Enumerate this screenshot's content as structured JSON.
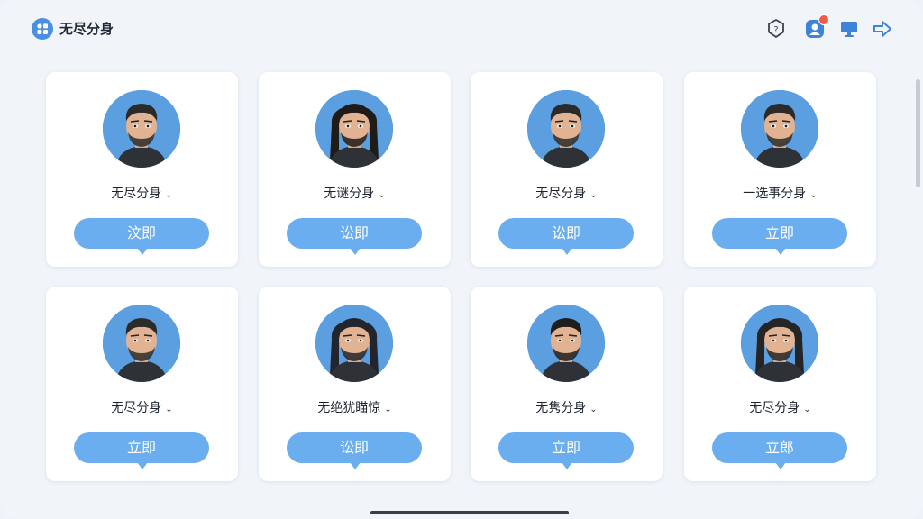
{
  "app": {
    "title": "无尽分身"
  },
  "toolbar": {
    "icons": [
      "help-icon",
      "profile-notify-icon",
      "monitor-icon",
      "forward-arrow-icon"
    ]
  },
  "colors": {
    "accent": "#6aaef0",
    "avatar_bg": "#5b9fe0",
    "badge": "#f05a4a"
  },
  "cards": [
    {
      "name": "无尽分身",
      "button": "汶即",
      "hair": "#2b2b2b",
      "long_hair": false
    },
    {
      "name": "无谜分身",
      "button": "讼即",
      "hair": "#1e1b18",
      "long_hair": true
    },
    {
      "name": "无尽分身",
      "button": "讼即",
      "hair": "#2a2a2a",
      "long_hair": false
    },
    {
      "name": "一选事分身",
      "button": "立即",
      "hair": "#2b2b2b",
      "long_hair": false
    },
    {
      "name": "无尽分身",
      "button": "立即",
      "hair": "#2b2b2b",
      "long_hair": false
    },
    {
      "name": "无绝犹瞄惊",
      "button": "讼即",
      "hair": "#23252e",
      "long_hair": true
    },
    {
      "name": "无隽分身",
      "button": "立即",
      "hair": "#1e1e1e",
      "long_hair": false
    },
    {
      "name": "无尽分身",
      "button": "立郎",
      "hair": "#252525",
      "long_hair": true
    }
  ]
}
